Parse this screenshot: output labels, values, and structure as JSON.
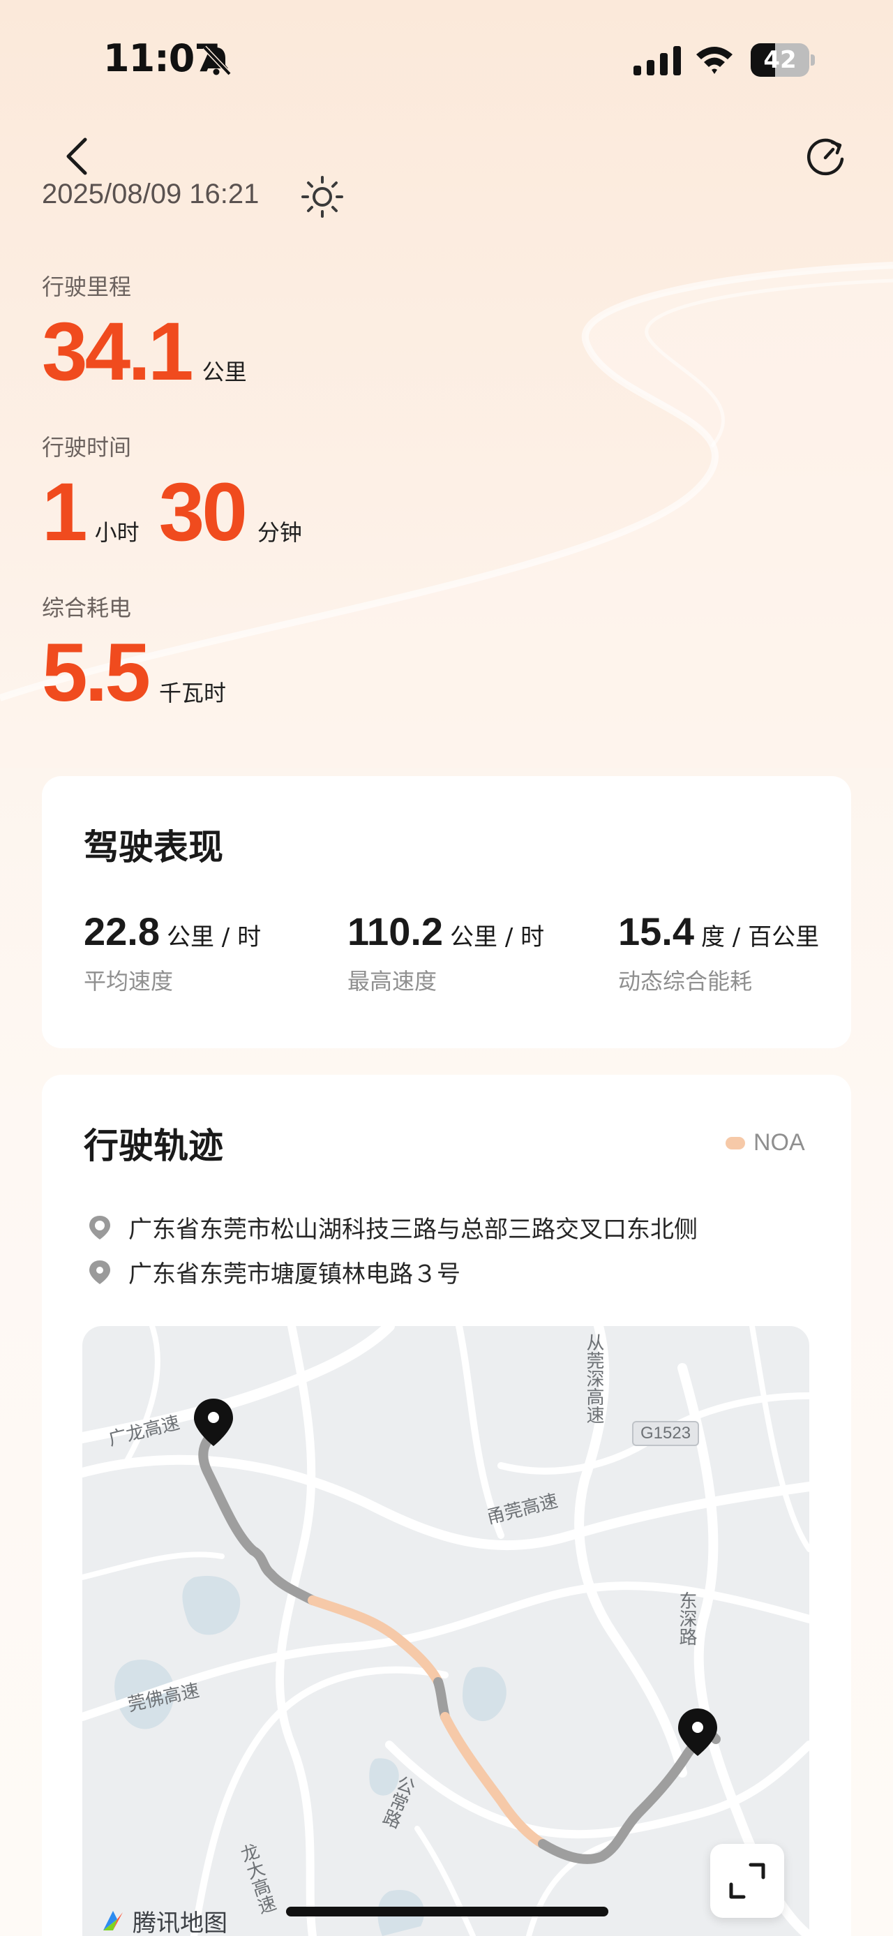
{
  "status_bar": {
    "time": "11:07",
    "battery": "42",
    "battery_level": 0.42,
    "icons": [
      "bell-muted-icon",
      "cellular-signal-icon",
      "wifi-icon",
      "battery-icon"
    ]
  },
  "header": {
    "date": "2025/08/09 16:21",
    "icons": [
      "back-icon",
      "refresh-icon",
      "sun-icon"
    ]
  },
  "stats": {
    "distance_label": "行驶里程",
    "distance_value": "34.1",
    "distance_unit": "公里",
    "duration_label": "行驶时间",
    "duration_hours": "1",
    "duration_hours_unit": "小时",
    "duration_minutes": "30",
    "duration_minutes_unit": "分钟",
    "energy_label": "综合耗电",
    "energy_value": "5.5",
    "energy_unit": "千瓦时"
  },
  "performance": {
    "title": "驾驶表现",
    "metrics": [
      {
        "value": "22.8",
        "unit": "公里 / 时",
        "label": "平均速度"
      },
      {
        "value": "110.2",
        "unit": "公里 / 时",
        "label": "最高速度"
      },
      {
        "value": "15.4",
        "unit": "度 / 百公里",
        "label": "动态综合能耗"
      }
    ]
  },
  "track": {
    "title": "行驶轨迹",
    "legend": "NOA",
    "legend_color": "#f6c9a8",
    "start_address": "广东省东莞市松山湖科技三路与总部三路交叉口东北侧",
    "end_address": "广东省东莞市塘厦镇林电路３号",
    "map": {
      "road_labels": [
        "广龙高速",
        "从莞深高速",
        "G1523",
        "甬莞高速",
        "东深路",
        "莞佛高速",
        "公常路",
        "龙大高速"
      ],
      "brand": "腾讯地图",
      "route_color": "#9a9a9a",
      "noa_color": "#f6c9a8"
    }
  }
}
